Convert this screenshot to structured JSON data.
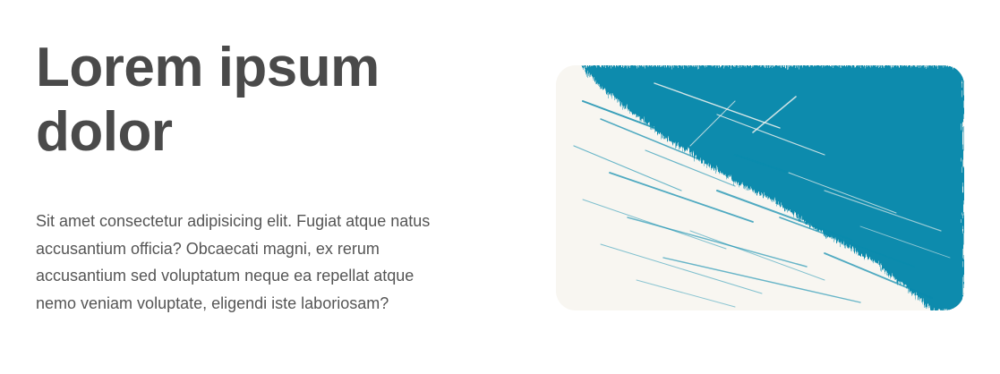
{
  "hero": {
    "title_line1": "Lorem ipsum",
    "title_line2": "dolor",
    "body": "Sit amet consectetur adipisicing elit. Fugiat atque natus accusantium officia? Obcaecati magni, ex rerum accusantium sed voluptatum neque ea repellat atque nemo veniam voluptate, eligendi iste laboriosam?"
  },
  "image": {
    "subject": "teal brush stroke texture on cream background",
    "colors": {
      "teal": "#0a8bad",
      "cream": "#f8f6f1"
    }
  },
  "colors": {
    "heading": "#4a4a4a",
    "body_text": "#555555",
    "background": "#ffffff"
  }
}
